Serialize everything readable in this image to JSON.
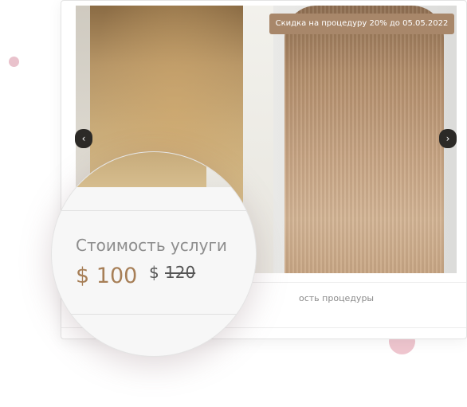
{
  "promo": {
    "badge_text": "Скидка на процедуру 20% до 05.05.2022"
  },
  "slider": {
    "prev_icon": "chevron-left-icon",
    "next_icon": "chevron-right-icon",
    "prev_glyph": "‹",
    "next_glyph": "›"
  },
  "details": {
    "duration_label_partial": "ость процедуры"
  },
  "price": {
    "label": "Стоимость услуги",
    "current": "$ 100",
    "old_currency": "$",
    "old_amount": "120"
  },
  "colors": {
    "accent": "#a77f57",
    "badge_bg": "#a8876a",
    "decor_pink": "#efc6cf"
  }
}
